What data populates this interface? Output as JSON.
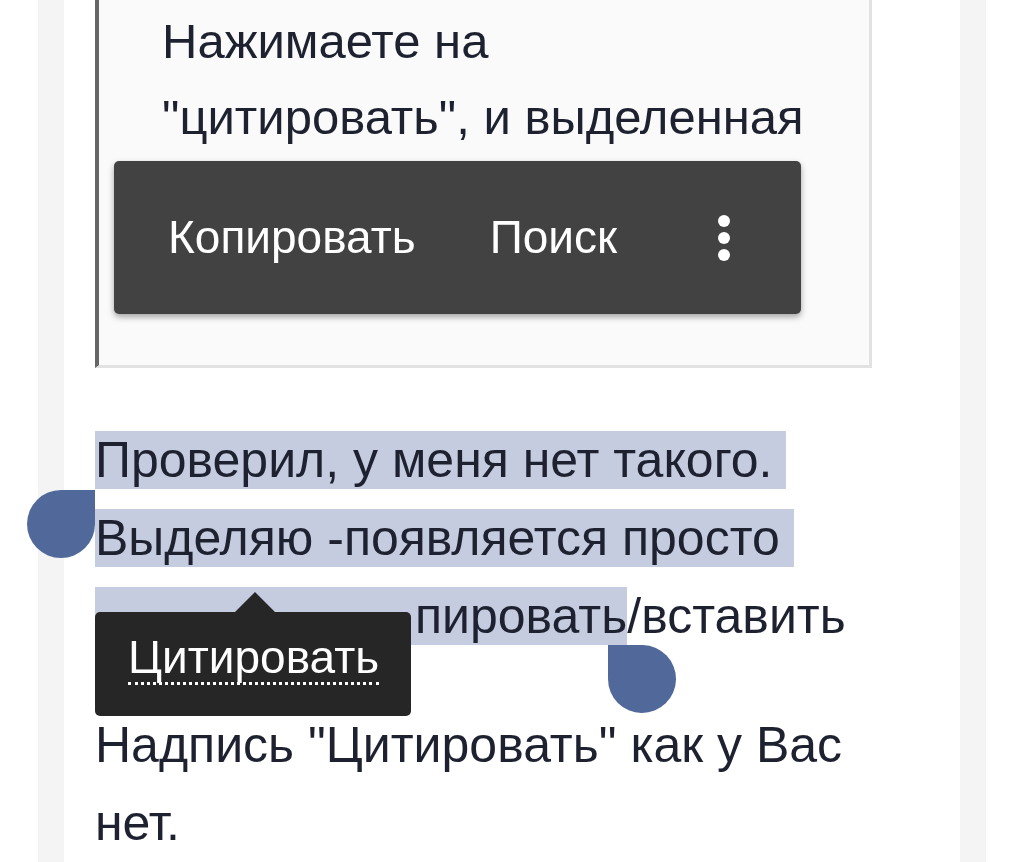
{
  "quote": {
    "lines": [
      "Нажимаете на",
      "\"цитировать\", и выделенная"
    ]
  },
  "context_menu": {
    "items": [
      "Копировать",
      "Поиск"
    ],
    "more": true
  },
  "paragraphs": [
    {
      "lines": [
        [
          {
            "text": "Проверил, у меня нет такого. ",
            "selected": true
          }
        ],
        [
          {
            "text": "Выделяю -появляется просто ",
            "selected": true
          }
        ],
        [
          {
            "text": "пировать",
            "selected": true
          },
          {
            "text": "/вставить",
            "selected": false
          }
        ]
      ]
    },
    {
      "lines": [
        [
          {
            "text": "Надпись \"Цитировать\" как у Вас",
            "selected": false
          }
        ],
        [
          {
            "text": "нет.",
            "selected": false
          }
        ]
      ]
    }
  ],
  "quote_tooltip": {
    "label": "Цитировать"
  }
}
